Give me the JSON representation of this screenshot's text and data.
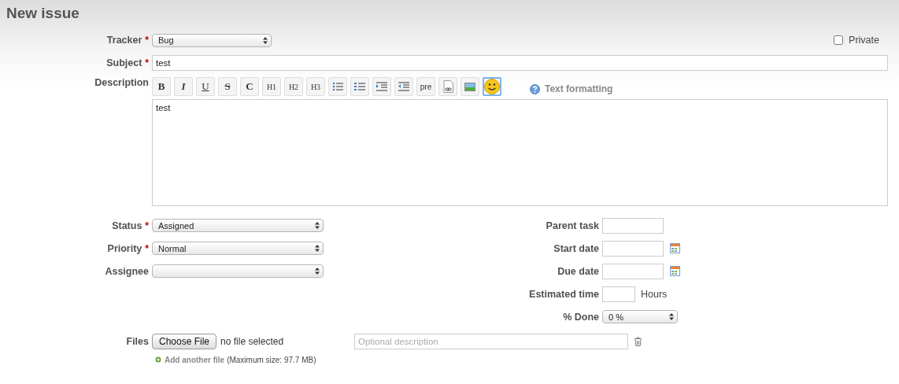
{
  "title": "New issue",
  "required_marker": "*",
  "tracker": {
    "label": "Tracker",
    "required": true,
    "value": "Bug"
  },
  "private": {
    "label": "Private",
    "checked": false
  },
  "subject": {
    "label": "Subject",
    "required": true,
    "value": "test"
  },
  "description": {
    "label": "Description",
    "value": "test",
    "help": "Text formatting",
    "toolbar": [
      {
        "kind": "text",
        "text": "B",
        "selected": false
      },
      {
        "kind": "text",
        "text": "I",
        "selected": false
      },
      {
        "kind": "text",
        "text": "U",
        "selected": false
      },
      {
        "kind": "text",
        "text": "S",
        "selected": false
      },
      {
        "kind": "text",
        "text": "C",
        "selected": false
      },
      {
        "kind": "text",
        "text": "H1",
        "selected": false
      },
      {
        "kind": "text",
        "text": "H2",
        "selected": false
      },
      {
        "kind": "text",
        "text": "H3",
        "selected": false
      },
      {
        "kind": "bullets",
        "selected": false
      },
      {
        "kind": "numbers",
        "selected": false
      },
      {
        "kind": "indent",
        "selected": false
      },
      {
        "kind": "outdent",
        "selected": false
      },
      {
        "kind": "text",
        "text": "pre",
        "selected": false
      },
      {
        "kind": "link",
        "selected": false
      },
      {
        "kind": "image",
        "selected": false
      },
      {
        "kind": "smiley",
        "selected": true
      }
    ]
  },
  "left_fields": [
    {
      "label": "Status",
      "required": true,
      "value": "Assigned"
    },
    {
      "label": "Priority",
      "required": true,
      "value": "Normal"
    },
    {
      "label": "Assignee",
      "required": false
    }
  ],
  "right_fields": [
    {
      "kind": "input",
      "label": "Parent task"
    },
    {
      "kind": "date",
      "label": "Start date"
    },
    {
      "kind": "date",
      "label": "Due date"
    },
    {
      "kind": "hours",
      "label": "Estimated time",
      "unit": "Hours"
    },
    {
      "kind": "select",
      "label": "% Done",
      "value": "0 %"
    }
  ],
  "files": {
    "label": "Files",
    "button": "Choose File",
    "status": "no file selected",
    "placeholder": "Optional description",
    "add_link": "Add another file",
    "max_size": "(Maximum size: 97.7 MB)"
  }
}
